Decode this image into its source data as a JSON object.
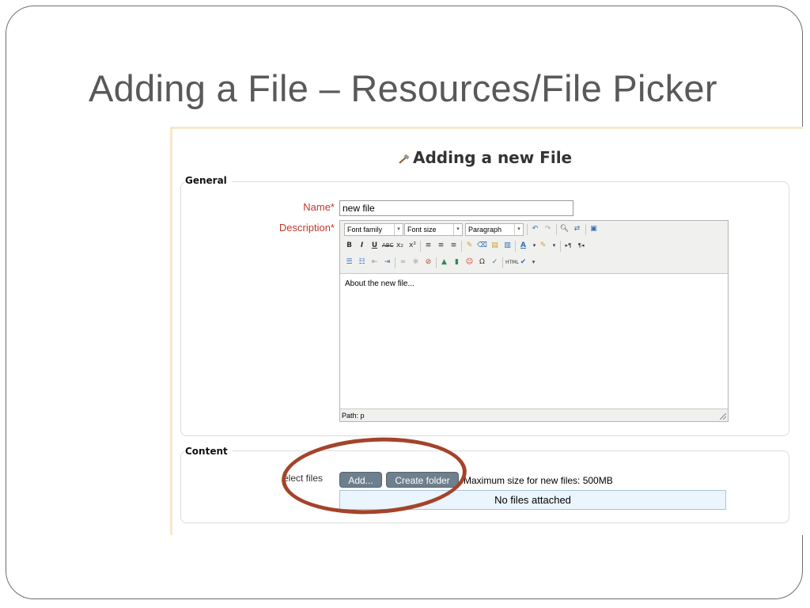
{
  "slide": {
    "title": "Adding a File – Resources/File Picker"
  },
  "page": {
    "heading": "Adding a new File"
  },
  "general": {
    "legend": "General",
    "name_label": "Name*",
    "name_value": "new file",
    "description_label": "Description*"
  },
  "editor": {
    "font_family": "Font family",
    "font_size": "Font size",
    "paragraph": "Paragraph",
    "content": "About the new file...",
    "path": "Path: p"
  },
  "content": {
    "legend": "Content",
    "select_files_label": "elect files",
    "add_button": "Add...",
    "create_folder_button": "Create folder",
    "max_size": "Maximum size for new files: 500MB",
    "files_status": "No files attached"
  },
  "colors": {
    "accent_oval": "#a4432b",
    "button_bg": "#6e7f8e",
    "required_label": "#c0392b"
  }
}
